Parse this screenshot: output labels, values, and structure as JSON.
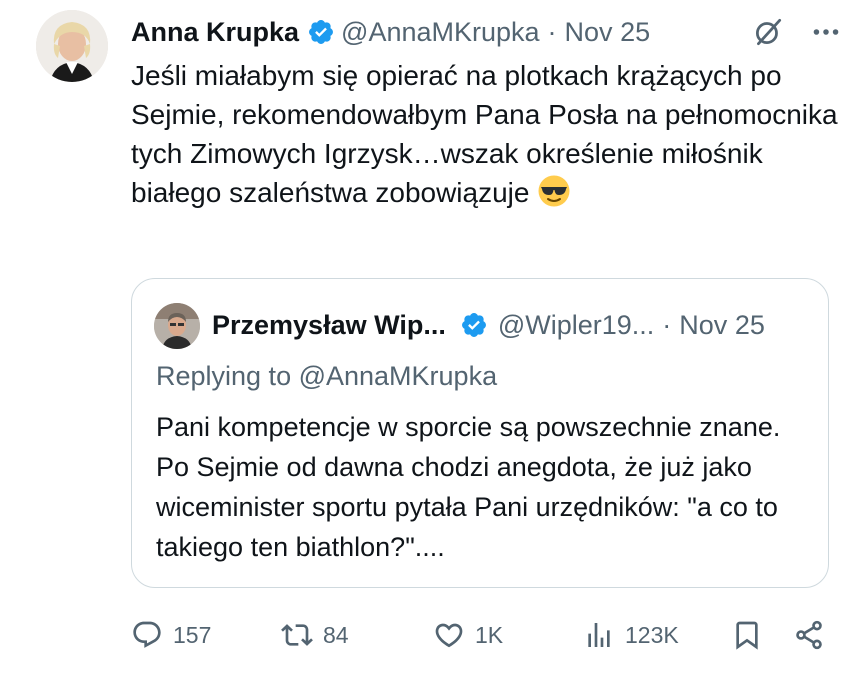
{
  "tweet": {
    "author_name": "Anna Krupka",
    "author_handle": "@AnnaMKrupka",
    "separator": "·",
    "date": "Nov 25",
    "text": "Jeśli miałabym się opierać na plotkach krążących po Sejmie, rekomendowałbym Pana Posła na pełnomocnika tych Zimowych Igrzysk…wszak określenie miłośnik białego szaleństwa zobowiązuje",
    "emoji": "sunglasses-emoji"
  },
  "quote": {
    "author_name": "Przemysław Wip...",
    "author_handle": "@Wipler19...",
    "separator": "·",
    "date": "Nov 25",
    "replying_to": "Replying to @AnnaMKrupka",
    "text": "Pani kompetencje w sporcie są powszechnie znane. Po Sejmie od dawna chodzi anegdota, że już jako wiceminister sportu pytała Pani urzędników: \"a co to takiego ten biathlon?\"...."
  },
  "actions": {
    "replies": "157",
    "reposts": "84",
    "likes": "1K",
    "views": "123K"
  },
  "icons": [
    "verified-badge-icon",
    "grok-icon",
    "more-icon",
    "reply-icon",
    "repost-icon",
    "like-icon",
    "views-icon",
    "bookmark-icon",
    "share-icon"
  ],
  "colors": {
    "verified": "#1d9bf0",
    "text": "#0f1419",
    "muted": "#536471",
    "border": "#cfd9de"
  }
}
